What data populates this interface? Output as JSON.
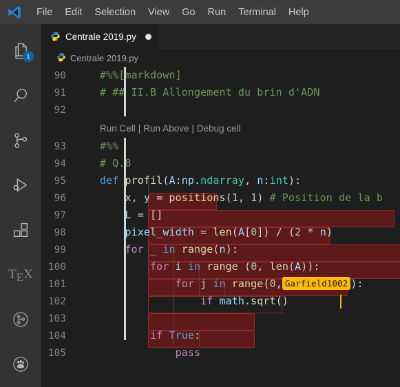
{
  "window": {
    "logo_icon": "vscode-logo-icon"
  },
  "menubar": {
    "items": [
      {
        "label": "File"
      },
      {
        "label": "Edit"
      },
      {
        "label": "Selection"
      },
      {
        "label": "View"
      },
      {
        "label": "Go"
      },
      {
        "label": "Run"
      },
      {
        "label": "Terminal"
      },
      {
        "label": "Help"
      }
    ]
  },
  "activitybar": {
    "items": [
      {
        "name": "explorer",
        "icon": "files-icon",
        "badge": "1"
      },
      {
        "name": "search",
        "icon": "search-icon",
        "badge": ""
      },
      {
        "name": "source-control",
        "icon": "source-control-icon",
        "badge": ""
      },
      {
        "name": "run-and-debug",
        "icon": "run-debug-icon",
        "badge": ""
      },
      {
        "name": "extensions",
        "icon": "extensions-icon",
        "badge": ""
      },
      {
        "name": "latex-workshop",
        "icon": "tex-icon",
        "badge": ""
      },
      {
        "name": "git-graph",
        "icon": "git-graph-circle-icon",
        "badge": ""
      },
      {
        "name": "paw",
        "icon": "paw-print-icon",
        "badge": ""
      }
    ]
  },
  "tabs": {
    "active": {
      "label": "Centrale 2019.py",
      "icon": "python-file-icon",
      "dirty": true
    }
  },
  "breadcrumb": {
    "icon": "python-file-icon",
    "label": "Centrale 2019.py"
  },
  "codelens": {
    "run_cell": "Run Cell",
    "sep1": "|",
    "run_above": "Run Above",
    "sep2": "|",
    "debug_cell": "Debug cell"
  },
  "editor": {
    "lines": [
      {
        "num": "90",
        "text": "#%%[markdown]"
      },
      {
        "num": "91",
        "text": "# ## II.B Allongement du brin d'ADN"
      },
      {
        "num": "92",
        "text": ""
      },
      {
        "num": "93",
        "text": "#%%"
      },
      {
        "num": "94",
        "text": "# Q.8"
      },
      {
        "num": "95",
        "text": "def profil(A:np.ndarray, n:int):"
      },
      {
        "num": "96",
        "text": "    x, y = positions(1, 1) # Position de la b"
      },
      {
        "num": "97",
        "text": "    L = []"
      },
      {
        "num": "98",
        "text": "    pixel_width = len(A[0]) / (2 * n)"
      },
      {
        "num": "99",
        "text": "    for _ in range(n):"
      },
      {
        "num": "100",
        "text": "        for i in range (0, len(A)):"
      },
      {
        "num": "101",
        "text": "            for j in range(0,Garfield1002):"
      },
      {
        "num": "102",
        "text": "                if math.sqrt()"
      },
      {
        "num": "103",
        "text": ""
      },
      {
        "num": "104",
        "text": "        if True:"
      },
      {
        "num": "105",
        "text": "            pass"
      }
    ],
    "inline_suggestion": "Garfield1002"
  },
  "colors": {
    "titlebar_bg": "#3c3c3c",
    "activitybar_bg": "#333333",
    "editor_bg": "#1e1e1e",
    "tabbar_bg": "#252526",
    "selection_red": "#5e1a1a",
    "selection_border": "#8a2a2a",
    "badge_blue": "#0e639c",
    "suggest_amber": "#ffb911",
    "comment_green": "#6a9955",
    "keyword_purple": "#c586c0",
    "keyword_blue": "#569cd6",
    "function_yellow": "#dcdcaa",
    "variable_blue": "#9cdcfe",
    "type_teal": "#4ec9b0",
    "number_green": "#b5cea8",
    "cellbar_gray": "#d4d4d4"
  }
}
